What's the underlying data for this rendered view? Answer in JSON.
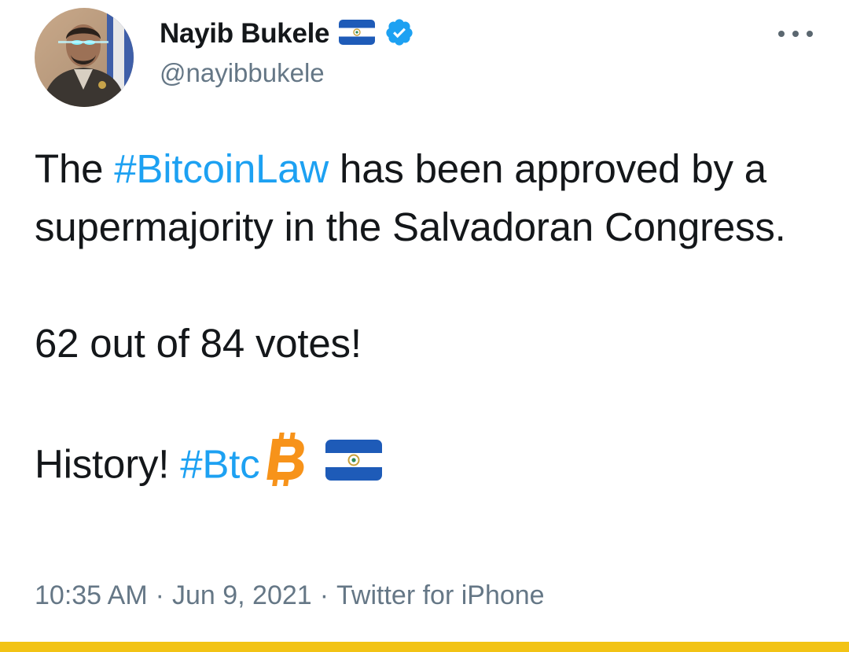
{
  "tweet": {
    "author": {
      "display_name": "Nayib Bukele",
      "handle": "@nayibbukele",
      "verified": true,
      "flag_icon": "el-salvador-flag-icon"
    },
    "body": {
      "line1_prefix": "The",
      "hashtag_bitcoinlaw": "#BitcoinLaw",
      "line1_rest": "has been approved by a supermajority in the Salvadoran Congress.",
      "votes": "62 out of 84 votes!",
      "history": "History!",
      "hashtag_btc": "#Btc"
    },
    "meta": {
      "time": "10:35 AM",
      "date": "Jun 9, 2021",
      "source": "Twitter for iPhone",
      "separator": "·"
    }
  },
  "colors": {
    "link": "#1da1f2",
    "secondary_text": "#657786",
    "bitcoin": "#f7931a",
    "flag_blue": "#1e5bb8",
    "bottom_bar": "#f2c314"
  }
}
